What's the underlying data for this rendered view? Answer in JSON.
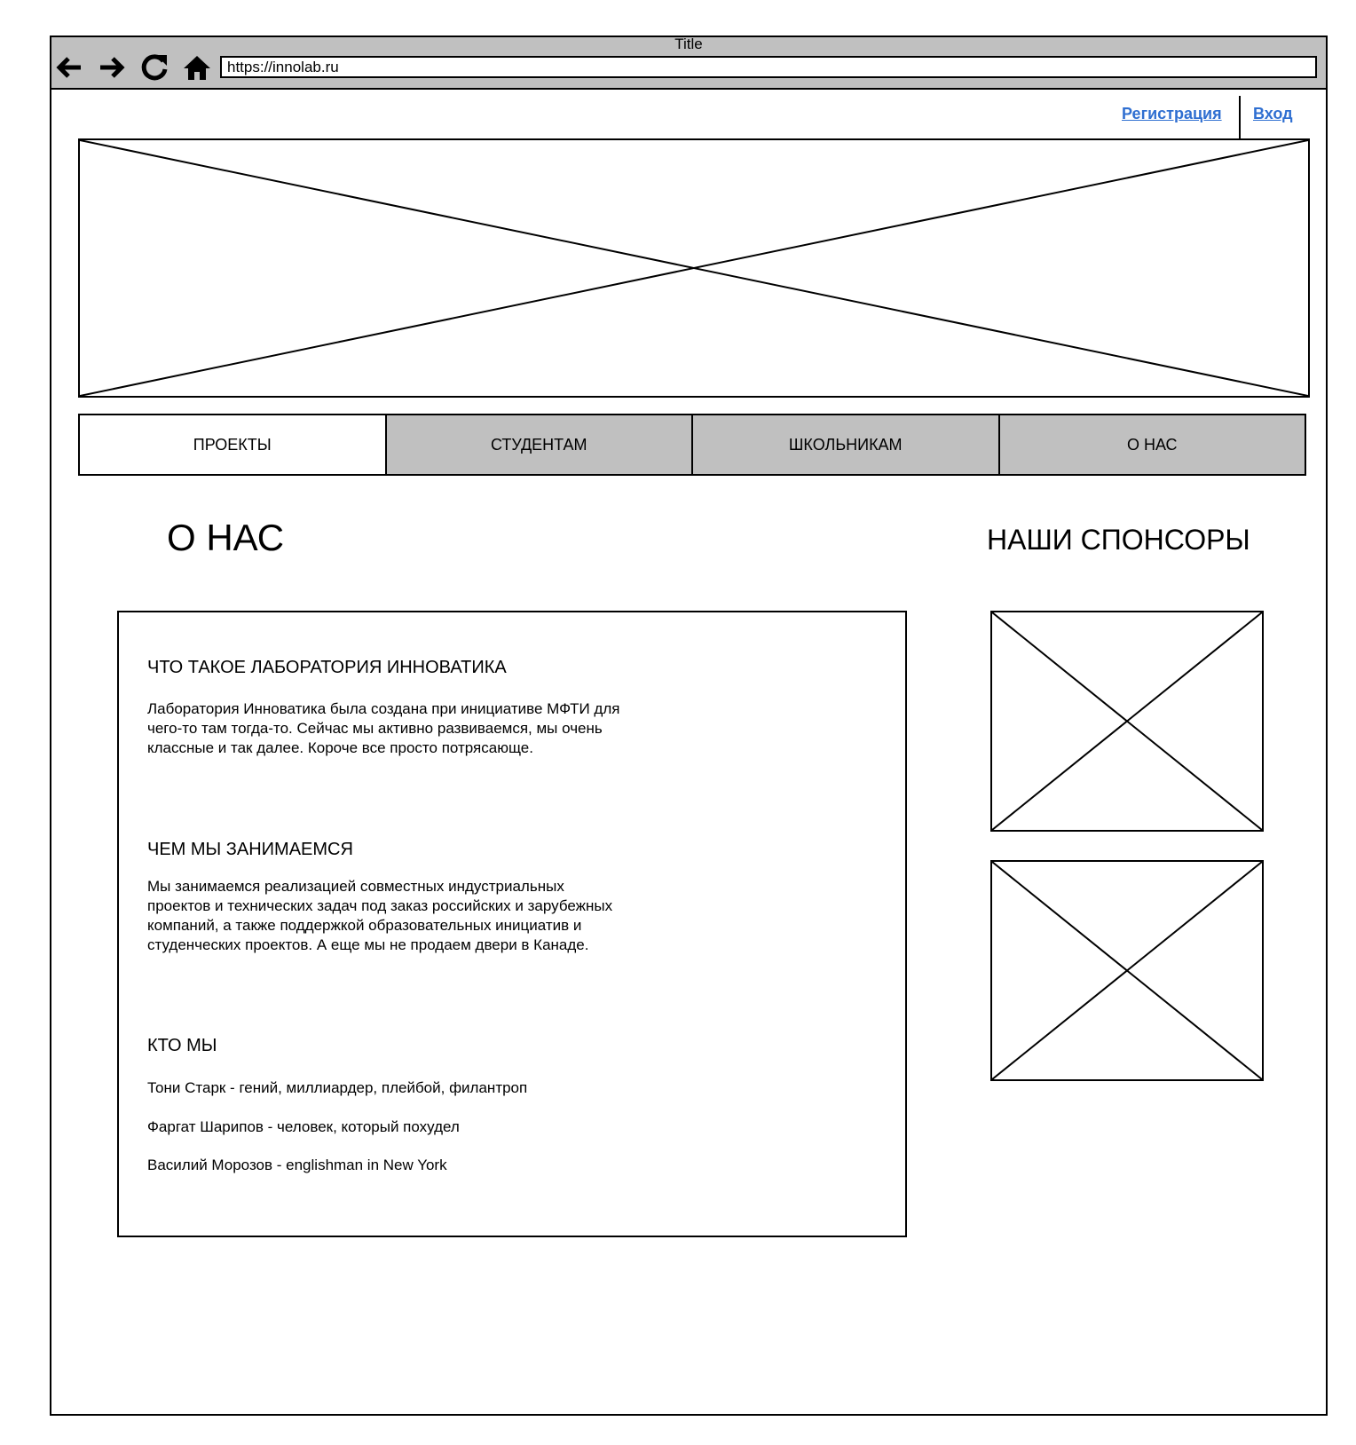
{
  "window": {
    "title": "Title"
  },
  "toolbar": {
    "back_icon": "arrow-left-icon",
    "forward_icon": "arrow-right-icon",
    "reload_icon": "reload-icon",
    "home_icon": "home-icon",
    "url": "https://innolab.ru"
  },
  "auth": {
    "register": "Регистрация",
    "login": "Вход",
    "link_color": "#2f6fd1"
  },
  "nav": {
    "tabs": [
      {
        "label": "ПРОЕКТЫ",
        "active": true
      },
      {
        "label": "СТУДЕНТАМ",
        "active": false
      },
      {
        "label": "ШКОЛЬНИКАМ",
        "active": false
      },
      {
        "label": "О НАС",
        "active": false
      }
    ],
    "inactive_color": "#c0c0c0"
  },
  "main": {
    "title": "О НАС",
    "sections": [
      {
        "heading": "ЧТО ТАКОЕ ЛАБОРАТОРИЯ ИННОВАТИКА",
        "text": "Лаборатория Инноватика была создана при инициативе МФТИ для чего-то там тогда-то. Сейчас мы активно развиваемся, мы очень классные и так далее. Короче все просто потрясающе."
      },
      {
        "heading": "ЧЕМ МЫ ЗАНИМАЕМСЯ",
        "text": "Мы занимаемся реализацией совместных индустриальных проектов и технических задач под заказ российских и зарубежных компаний, а также поддержкой образовательных инициатив и студенческих проектов. А еще мы не продаем двери в Канаде."
      },
      {
        "heading": "КТО МЫ",
        "people": [
          "Тони Старк - гений, миллиардер, плейбой, филантроп",
          "Фаргат Шарипов - человек, который похудел",
          "Василий Морозов - englishman in New York"
        ]
      }
    ]
  },
  "sponsors": {
    "title": "НАШИ СПОНСОРЫ",
    "logo_count": 2
  }
}
